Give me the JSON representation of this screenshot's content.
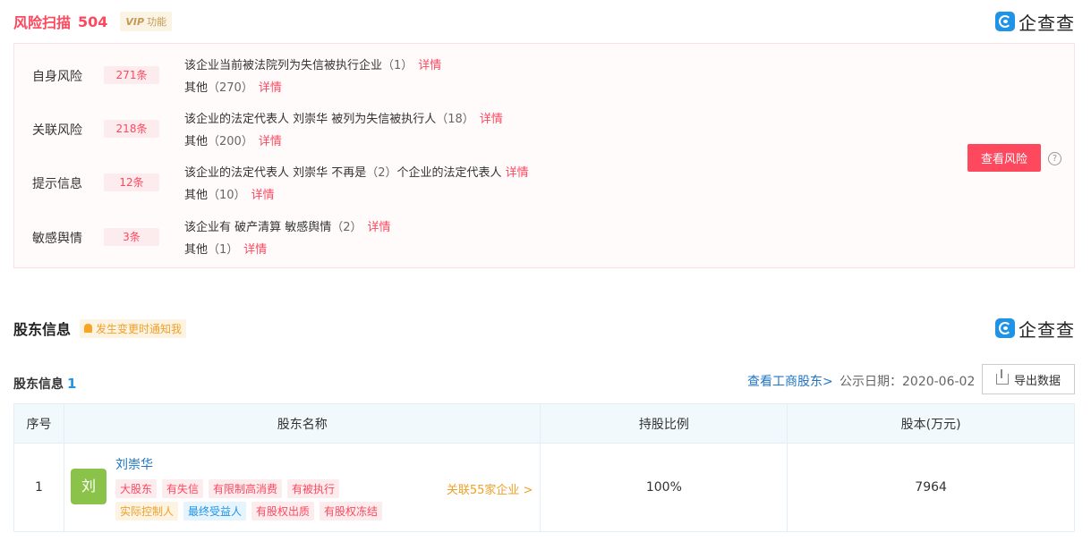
{
  "risk": {
    "title": "风险扫描",
    "count": "504",
    "vip_badge_mark": "VIP",
    "vip_badge_text": "功能",
    "logo_text": "企查查",
    "rows": [
      {
        "label": "自身风险",
        "tag": "271条",
        "line1_text": "该企业当前被法院列为失信被执行企业",
        "line1_num": "（1）",
        "line1_link": "详情",
        "line2_text": "其他",
        "line2_num": "（270）",
        "line2_link": "详情"
      },
      {
        "label": "关联风险",
        "tag": "218条",
        "line1_text": "该企业的法定代表人 刘崇华 被列为失信被执行人",
        "line1_num": "（18）",
        "line1_link": "详情",
        "line2_text": "其他",
        "line2_num": "（200）",
        "line2_link": "详情"
      },
      {
        "label": "提示信息",
        "tag": "12条",
        "line1_text": "该企业的法定代表人 刘崇华 不再是",
        "line1_num": "（2）",
        "line1_after": "个企业的法定代表人",
        "line1_link": "详情",
        "line2_text": "其他",
        "line2_num": "（10）",
        "line2_link": "详情"
      },
      {
        "label": "敏感舆情",
        "tag": "3条",
        "line1_text": "该企业有 破产清算 敏感舆情",
        "line1_num": "（2）",
        "line1_link": "详情",
        "line2_text": "其他",
        "line2_num": "（1）",
        "line2_link": "详情"
      }
    ],
    "view_button": "查看风险",
    "help_glyph": "?"
  },
  "shareholders": {
    "title": "股东信息",
    "notify_badge": "发生变更时通知我",
    "logo_text": "企查查",
    "sub_title": "股东信息",
    "sub_count": "1",
    "link_label": "查看工商股东>",
    "pub_date": "公示日期：2020-06-02",
    "export_label": "导出数据",
    "columns": [
      "序号",
      "股东名称",
      "持股比例",
      "股本(万元)"
    ],
    "rows": [
      {
        "index": "1",
        "avatar": "刘",
        "name": "刘崇华",
        "tags_row1": [
          "大股东",
          "有失信",
          "有限制高消费",
          "有被执行"
        ],
        "tags_row2_orange": "实际控制人",
        "tags_row2_blue": "最终受益人",
        "tags_row2_red": [
          "有股权出质",
          "有股权冻结"
        ],
        "associated": "关联55家企业 >",
        "ratio": "100%",
        "capital": "7964"
      }
    ]
  },
  "colors": {
    "accent_red": "#fd485e",
    "brand_blue": "#1f93e6",
    "link_blue": "#1f75c4",
    "orange": "#f0a028"
  }
}
